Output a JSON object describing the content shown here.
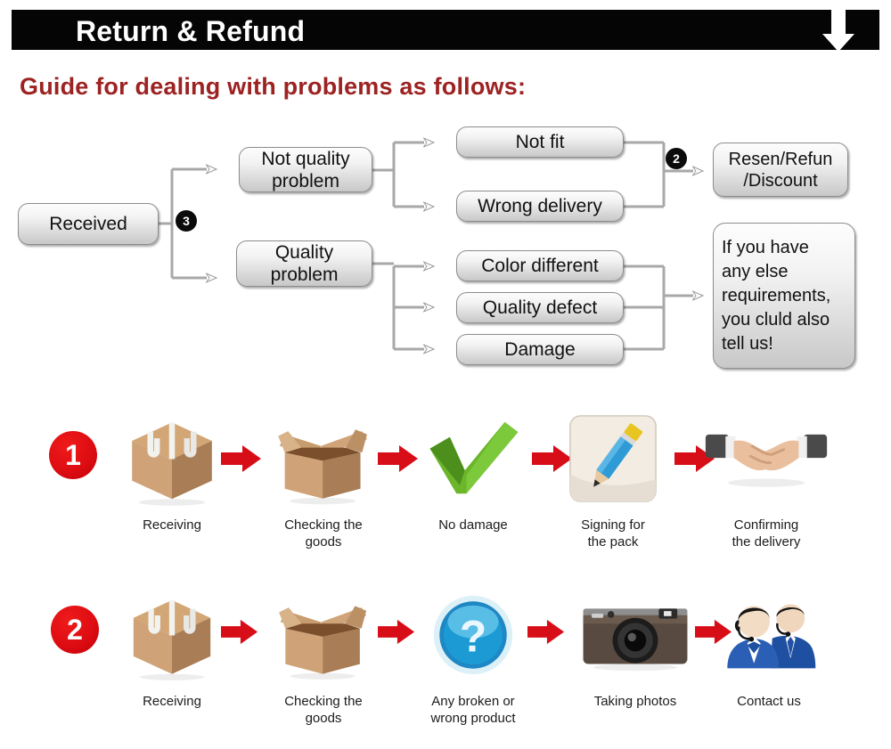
{
  "header": {
    "title": "Return & Refund",
    "arrow_icon": "down-arrow-icon",
    "bar_color": "#050505",
    "title_color": "#ffffff"
  },
  "guide": {
    "title": "Guide for dealing with problems as follows:",
    "color": "#9d2222"
  },
  "flowchart": {
    "nodes": {
      "received": "Received",
      "not_quality": "Not quality\nproblem",
      "quality": "Quality\nproblem",
      "not_fit": "Not fit",
      "wrong_delivery": "Wrong delivery",
      "color_different": "Color different",
      "quality_defect": "Quality defect",
      "damage": "Damage",
      "resend": "Resen/Refun\n/Discount",
      "if_you_have": "If you have\nany else\nrequirements,\nyou cluld also\ntell us!"
    },
    "badges": {
      "three": "3",
      "two": "2"
    },
    "edges": [
      {
        "from": "received",
        "to": "not_quality"
      },
      {
        "from": "received",
        "to": "quality"
      },
      {
        "from": "not_quality",
        "to": "not_fit"
      },
      {
        "from": "not_quality",
        "to": "wrong_delivery"
      },
      {
        "from": "quality",
        "to": "color_different"
      },
      {
        "from": "quality",
        "to": "quality_defect"
      },
      {
        "from": "quality",
        "to": "damage"
      },
      {
        "from": "not_fit",
        "to": "resend"
      },
      {
        "from": "wrong_delivery",
        "to": "resend"
      },
      {
        "from": "color_different",
        "to": "if_you_have"
      },
      {
        "from": "quality_defect",
        "to": "if_you_have"
      },
      {
        "from": "damage",
        "to": "if_you_have"
      }
    ]
  },
  "process": {
    "arrow_color": "#d70d18",
    "badge_color": "#de0d12",
    "rows": [
      {
        "number": "1",
        "steps": [
          {
            "icon": "closed-box-icon",
            "caption": "Receiving"
          },
          {
            "icon": "open-box-icon",
            "caption": "Checking the\ngoods"
          },
          {
            "icon": "green-check-icon",
            "caption": "No damage"
          },
          {
            "icon": "pencil-sign-icon",
            "caption": "Signing for\nthe pack"
          },
          {
            "icon": "handshake-icon",
            "caption": "Confirming\nthe delivery"
          }
        ]
      },
      {
        "number": "2",
        "steps": [
          {
            "icon": "closed-box-icon",
            "caption": "Receiving"
          },
          {
            "icon": "open-box-icon",
            "caption": "Checking the\ngoods"
          },
          {
            "icon": "question-mark-icon",
            "caption": "Any broken or\nwrong product"
          },
          {
            "icon": "camera-icon",
            "caption": "Taking photos"
          },
          {
            "icon": "support-agents-icon",
            "caption": "Contact us"
          }
        ]
      }
    ]
  }
}
